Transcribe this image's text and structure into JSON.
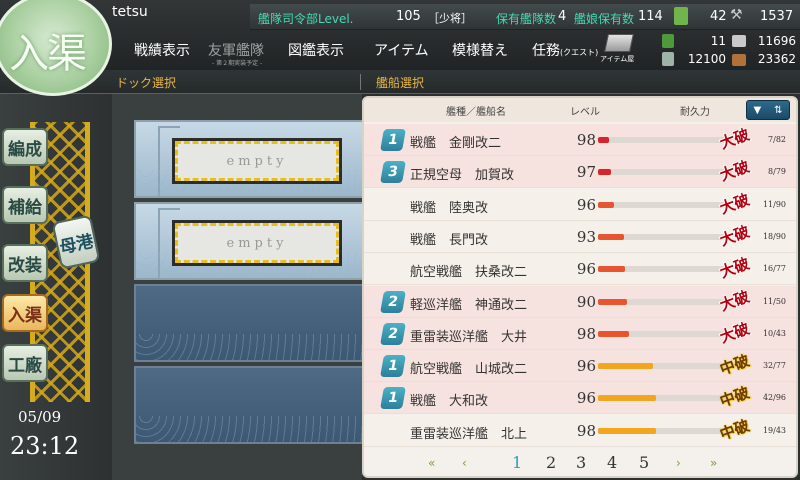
{
  "header": {
    "badge_label": "入渠",
    "admiral_name": "tetsu",
    "hq_level_label": "艦隊司令部Level.",
    "hq_level": "105",
    "rank": "［少将］",
    "fleet_count_label": "保有艦隊数",
    "fleet_count": "4",
    "ship_count_label": "艦娘保有数",
    "ship_count": "114",
    "bucket_count": "42",
    "devmat_count": "1537",
    "fuel": "11",
    "ammo": "11696",
    "steel": "12100",
    "bauxite": "23362"
  },
  "menu": {
    "items": [
      {
        "label": "戦績表示"
      },
      {
        "label": "友軍艦隊",
        "sub": "- 第２期実装予定 -"
      },
      {
        "label": "図鑑表示"
      },
      {
        "label": "アイテム"
      },
      {
        "label": "模様替え"
      },
      {
        "label": "任務",
        "suffix": "(クエスト)"
      }
    ],
    "furniture_label": "アイテム屋"
  },
  "sections": {
    "dock_select": "ドック選択",
    "ship_select": "艦船選択"
  },
  "sidebar": {
    "items": [
      "編成",
      "補給",
      "改装",
      "入渠",
      "工廠"
    ],
    "active_index": 3,
    "return_label": "母港",
    "date": "05/09",
    "time": "23:12"
  },
  "docks": [
    {
      "label": "empty",
      "locked": false
    },
    {
      "label": "empty",
      "locked": false
    },
    {
      "locked": true
    },
    {
      "locked": true
    }
  ],
  "ship_list": {
    "headers": {
      "type_name": "艦種／艦船名",
      "level": "レベル",
      "hp": "耐久力"
    },
    "sort_icon": "sort-icon",
    "ships": [
      {
        "fleet": "1",
        "name": "戦艦　金剛改二",
        "level": "98",
        "hp": "7/82",
        "hp_ratio": 0.085,
        "damage": "大破",
        "damage_type": "heavy",
        "row": "pink",
        "bar": "#d9232b"
      },
      {
        "fleet": "3",
        "name": "正規空母　加賀改",
        "level": "97",
        "hp": "8/79",
        "hp_ratio": 0.1,
        "damage": "大破",
        "damage_type": "heavy",
        "row": "pink",
        "bar": "#d9232b"
      },
      {
        "fleet": "",
        "name": "戦艦　陸奥改",
        "level": "96",
        "hp": "11/90",
        "hp_ratio": 0.122,
        "damage": "大破",
        "damage_type": "heavy",
        "row": "plain",
        "bar": "#e65530"
      },
      {
        "fleet": "",
        "name": "戦艦　長門改",
        "level": "93",
        "hp": "18/90",
        "hp_ratio": 0.2,
        "damage": "大破",
        "damage_type": "heavy",
        "row": "plain",
        "bar": "#e65530"
      },
      {
        "fleet": "",
        "name": "航空戦艦　扶桑改二",
        "level": "96",
        "hp": "16/77",
        "hp_ratio": 0.208,
        "damage": "大破",
        "damage_type": "heavy",
        "row": "plain",
        "bar": "#e65530"
      },
      {
        "fleet": "2",
        "name": "軽巡洋艦　神通改二",
        "level": "90",
        "hp": "11/50",
        "hp_ratio": 0.22,
        "damage": "大破",
        "damage_type": "heavy",
        "row": "pink",
        "bar": "#e65530"
      },
      {
        "fleet": "2",
        "name": "重雷装巡洋艦　大井",
        "level": "98",
        "hp": "10/43",
        "hp_ratio": 0.233,
        "damage": "大破",
        "damage_type": "heavy",
        "row": "pink",
        "bar": "#e65530"
      },
      {
        "fleet": "1",
        "name": "航空戦艦　山城改二",
        "level": "96",
        "hp": "32/77",
        "hp_ratio": 0.416,
        "damage": "中破",
        "damage_type": "moderate",
        "row": "pink",
        "bar": "#f2a51f"
      },
      {
        "fleet": "1",
        "name": "戦艦　大和改",
        "level": "96",
        "hp": "42/96",
        "hp_ratio": 0.4375,
        "damage": "中破",
        "damage_type": "moderate",
        "row": "pink",
        "bar": "#f2a51f"
      },
      {
        "fleet": "",
        "name": "重雷装巡洋艦　北上",
        "level": "98",
        "hp": "19/43",
        "hp_ratio": 0.442,
        "damage": "中破",
        "damage_type": "moderate",
        "row": "plain",
        "bar": "#f2a51f"
      }
    ]
  },
  "pager": {
    "pages": [
      "1",
      "2",
      "3",
      "4",
      "5"
    ],
    "current": "1",
    "first": "«",
    "prev": "‹",
    "next": "›",
    "last": "»"
  }
}
